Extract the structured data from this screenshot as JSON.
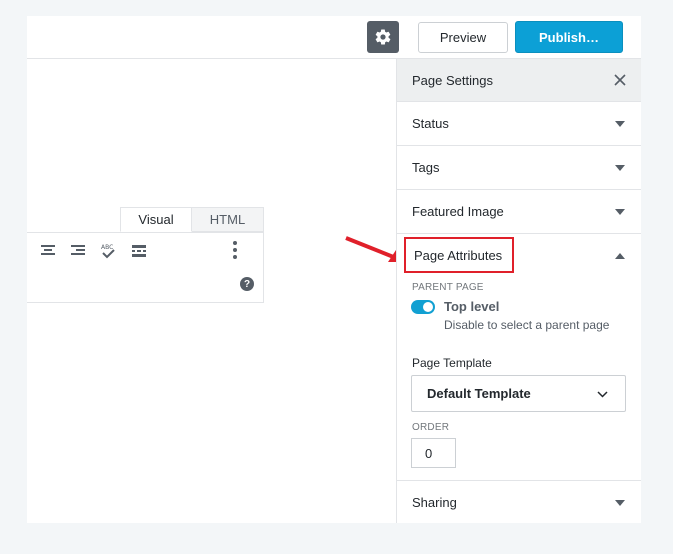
{
  "toolbar": {
    "settings_icon": "gear-icon",
    "preview_label": "Preview",
    "publish_label": "Publish…"
  },
  "editor": {
    "tabs": [
      {
        "label": "Visual",
        "active": true
      },
      {
        "label": "HTML",
        "active": false
      }
    ],
    "tools": [
      "align-center-icon",
      "align-right-icon",
      "spellcheck-icon",
      "read-more-icon",
      "more-vertical-icon"
    ],
    "help_icon_text": "?"
  },
  "sidebar": {
    "title": "Page Settings",
    "panels": {
      "status": "Status",
      "tags": "Tags",
      "featured_image": "Featured Image",
      "page_attributes": "Page Attributes",
      "sharing": "Sharing"
    },
    "page_attributes": {
      "parent_page_label": "PARENT PAGE",
      "toggle_label": "Top level",
      "toggle_on": true,
      "toggle_help": "Disable to select a parent page",
      "template_label": "Page Template",
      "template_value": "Default Template",
      "order_label": "ORDER",
      "order_value": "0"
    }
  },
  "colors": {
    "accent": "#0ca0d6",
    "highlight": "#e0202a",
    "toggle": "#11a0d2"
  }
}
